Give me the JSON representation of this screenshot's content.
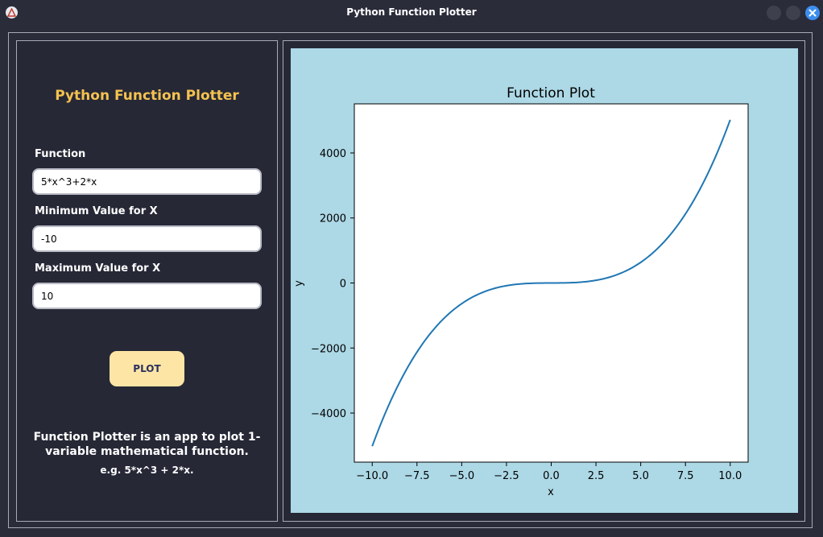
{
  "window": {
    "title": "Python Function Plotter",
    "icon": "triangle-logo-icon",
    "controls": [
      "minimize-icon",
      "maximize-icon",
      "close-icon"
    ]
  },
  "sidebar": {
    "title": "Python Function Plotter",
    "function_label": "Function",
    "function_value": "5*x^3+2*x",
    "min_label": "Minimum Value for X",
    "min_value": "-10",
    "max_label": "Maximum Value for X",
    "max_value": "10",
    "plot_button": "PLOT",
    "description": "Function Plotter is an app to plot 1-variable mathematical function.",
    "example": "e.g.  5*x^3 + 2*x."
  },
  "colors": {
    "accent": "#f5c24f",
    "button": "#fde6a5",
    "plot_background": "#add8e6",
    "line": "#1f77b4"
  },
  "chart_data": {
    "type": "line",
    "title": "Function Plot",
    "xlabel": "x",
    "ylabel": "y",
    "function": "5*x^3+2*x",
    "xlim": [
      -11.0,
      11.0
    ],
    "ylim": [
      -5510,
      5510
    ],
    "x_ticks": [
      -10.0,
      -7.5,
      -5.0,
      -2.5,
      0.0,
      2.5,
      5.0,
      7.5,
      10.0
    ],
    "x_tick_labels": [
      "−10.0",
      "−7.5",
      "−5.0",
      "−2.5",
      "0.0",
      "2.5",
      "5.0",
      "7.5",
      "10.0"
    ],
    "y_ticks": [
      4000,
      2000,
      0,
      -2000,
      -4000
    ],
    "y_tick_labels": [
      "4000",
      "2000",
      "0",
      "−2000",
      "−4000"
    ],
    "grid": false,
    "series": [
      {
        "x": [
          -10,
          -9,
          -8,
          -7,
          -6,
          -5,
          -4,
          -3,
          -2,
          -1,
          0,
          1,
          2,
          3,
          4,
          5,
          6,
          7,
          8,
          9,
          10
        ],
        "values": [
          -5020,
          -3663,
          -2576,
          -1729,
          -1092,
          -635,
          -328,
          -141,
          -44,
          -7,
          0,
          7,
          44,
          141,
          328,
          635,
          1092,
          1729,
          2576,
          3663,
          5020
        ]
      }
    ]
  }
}
